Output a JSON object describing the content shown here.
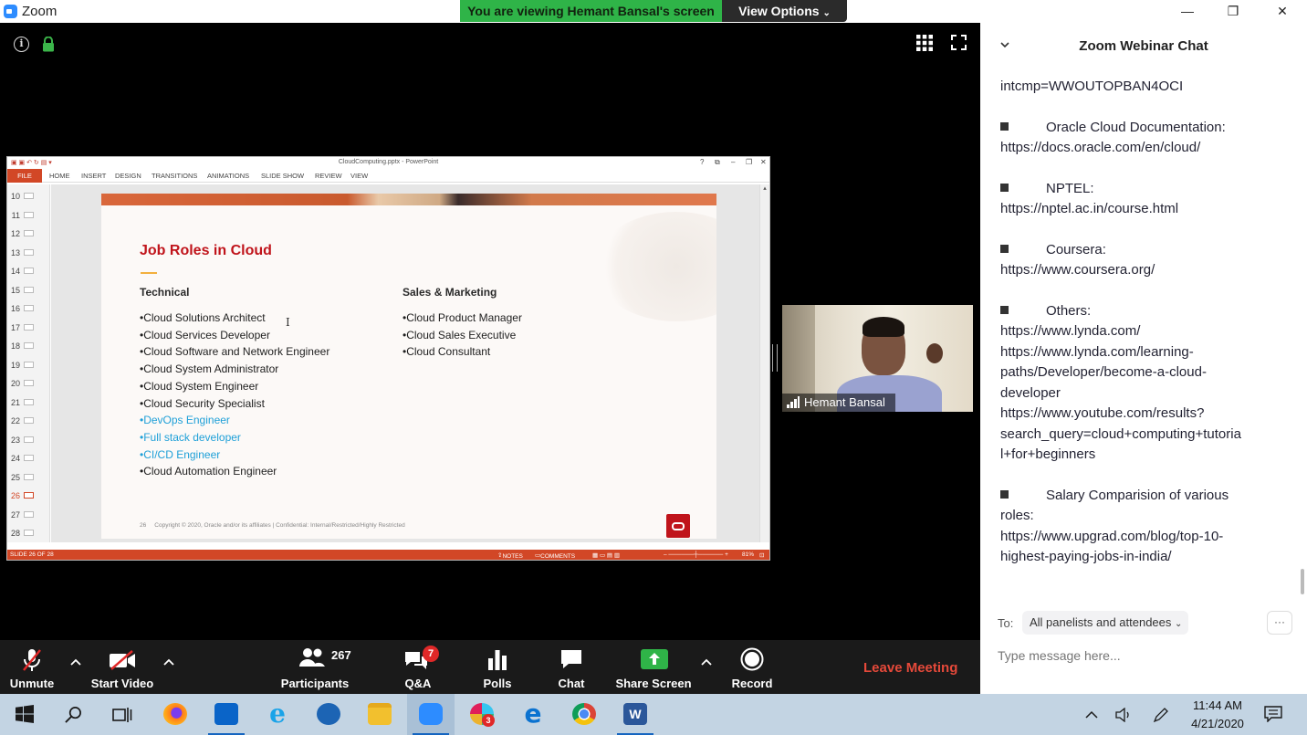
{
  "window": {
    "app_title": "Zoom",
    "viewing_banner": "You are viewing Hemant Bansal's screen",
    "view_options": "View Options",
    "controls": {
      "minimize": "—",
      "maximize": "❐",
      "close": "✕"
    }
  },
  "ppt": {
    "doc_title": "CloudComputing.pptx - PowerPoint",
    "window_ctrls": [
      "?",
      "⧉",
      "–",
      "❐",
      "✕"
    ],
    "tabs": [
      "FILE",
      "HOME",
      "INSERT",
      "DESIGN",
      "TRANSITIONS",
      "ANIMATIONS",
      "SLIDE SHOW",
      "REVIEW",
      "VIEW"
    ],
    "slide_numbers": [
      "10",
      "11",
      "12",
      "13",
      "14",
      "15",
      "16",
      "17",
      "18",
      "19",
      "20",
      "21",
      "22",
      "23",
      "24",
      "25",
      "26",
      "27",
      "28"
    ],
    "active_slide": "26",
    "status": {
      "slide_of": "SLIDE 26 OF 28",
      "notes": "NOTES",
      "comments": "COMMENTS",
      "zoom": "81%"
    },
    "slide": {
      "title": "Job Roles in Cloud",
      "col1_head": "Technical",
      "col1_items": [
        {
          "text": "•Cloud Solutions Architect",
          "color": "#1e1e1e"
        },
        {
          "text": "•Cloud Services Developer",
          "color": "#1e1e1e"
        },
        {
          "text": "•Cloud Software and Network Engineer",
          "color": "#1e1e1e"
        },
        {
          "text": "•Cloud System Administrator",
          "color": "#1e1e1e"
        },
        {
          "text": "•Cloud System Engineer",
          "color": "#1e1e1e"
        },
        {
          "text": "•Cloud Security Specialist",
          "color": "#1e1e1e"
        },
        {
          "text": "•DevOps Engineer",
          "color": "#1fa0d8"
        },
        {
          "text": "•Full stack developer",
          "color": "#1fa0d8"
        },
        {
          "text": "•CI/CD Engineer",
          "color": "#1fa0d8"
        },
        {
          "text": "•Cloud Automation Engineer",
          "color": "#1e1e1e"
        }
      ],
      "col2_head": "Sales & Marketing",
      "col2_items": [
        "•Cloud Product Manager",
        "•Cloud Sales Executive",
        "•Cloud Consultant"
      ],
      "footer_num": "26",
      "footer_text": "Copyright © 2020, Oracle and/or its affiliates  |  Confidential: Internal/Restricted/Highly Restricted"
    }
  },
  "video": {
    "name": "Hemant Bansal"
  },
  "chat": {
    "header": "Zoom Webinar Chat",
    "messages": [
      {
        "bullet": false,
        "lines": [
          "intcmp=WWOUTOPBAN4OCI"
        ]
      },
      {
        "bullet": true,
        "lines": [
          "Oracle Cloud Documentation:",
          "https://docs.oracle.com/en/cloud/"
        ]
      },
      {
        "bullet": true,
        "lines": [
          "NPTEL:",
          "https://nptel.ac.in/course.html"
        ]
      },
      {
        "bullet": true,
        "lines": [
          "Coursera:",
          "https://www.coursera.org/"
        ]
      },
      {
        "bullet": true,
        "lines": [
          "Others:",
          "https://www.lynda.com/",
          "https://www.lynda.com/learning-",
          "paths/Developer/become-a-cloud-",
          "developer",
          "https://www.youtube.com/results?",
          "search_query=cloud+computing+tutoria",
          "l+for+beginners"
        ]
      },
      {
        "bullet": true,
        "lines": [
          "Salary Comparision of various",
          "roles:",
          "https://www.upgrad.com/blog/top-10-",
          "highest-paying-jobs-in-india/"
        ]
      }
    ],
    "to_label": "To:",
    "to_value": "All panelists and attendees",
    "more": "···",
    "input_placeholder": "Type message here..."
  },
  "toolbar": {
    "unmute": "Unmute",
    "start_video": "Start Video",
    "participants": "Participants",
    "participants_count": "267",
    "qa": "Q&A",
    "qa_badge": "7",
    "polls": "Polls",
    "chat": "Chat",
    "share_screen": "Share Screen",
    "record": "Record",
    "leave": "Leave Meeting"
  },
  "taskbar": {
    "apps": [
      "firefox-icon",
      "outlook-icon",
      "ie-icon",
      "mail-icon",
      "file-explorer-icon",
      "zoom-icon",
      "slack-icon",
      "edge-icon",
      "chrome-icon",
      "word-icon"
    ],
    "slack_badge": "3",
    "time": "11:44 AM",
    "date": "4/21/2020"
  },
  "colors": {
    "zoom_blue": "#2D8CFF",
    "banner_green": "#2FB448",
    "leave_red": "#E5493A",
    "ppt_orange": "#D24726",
    "slide_title_red": "#C0141B"
  }
}
